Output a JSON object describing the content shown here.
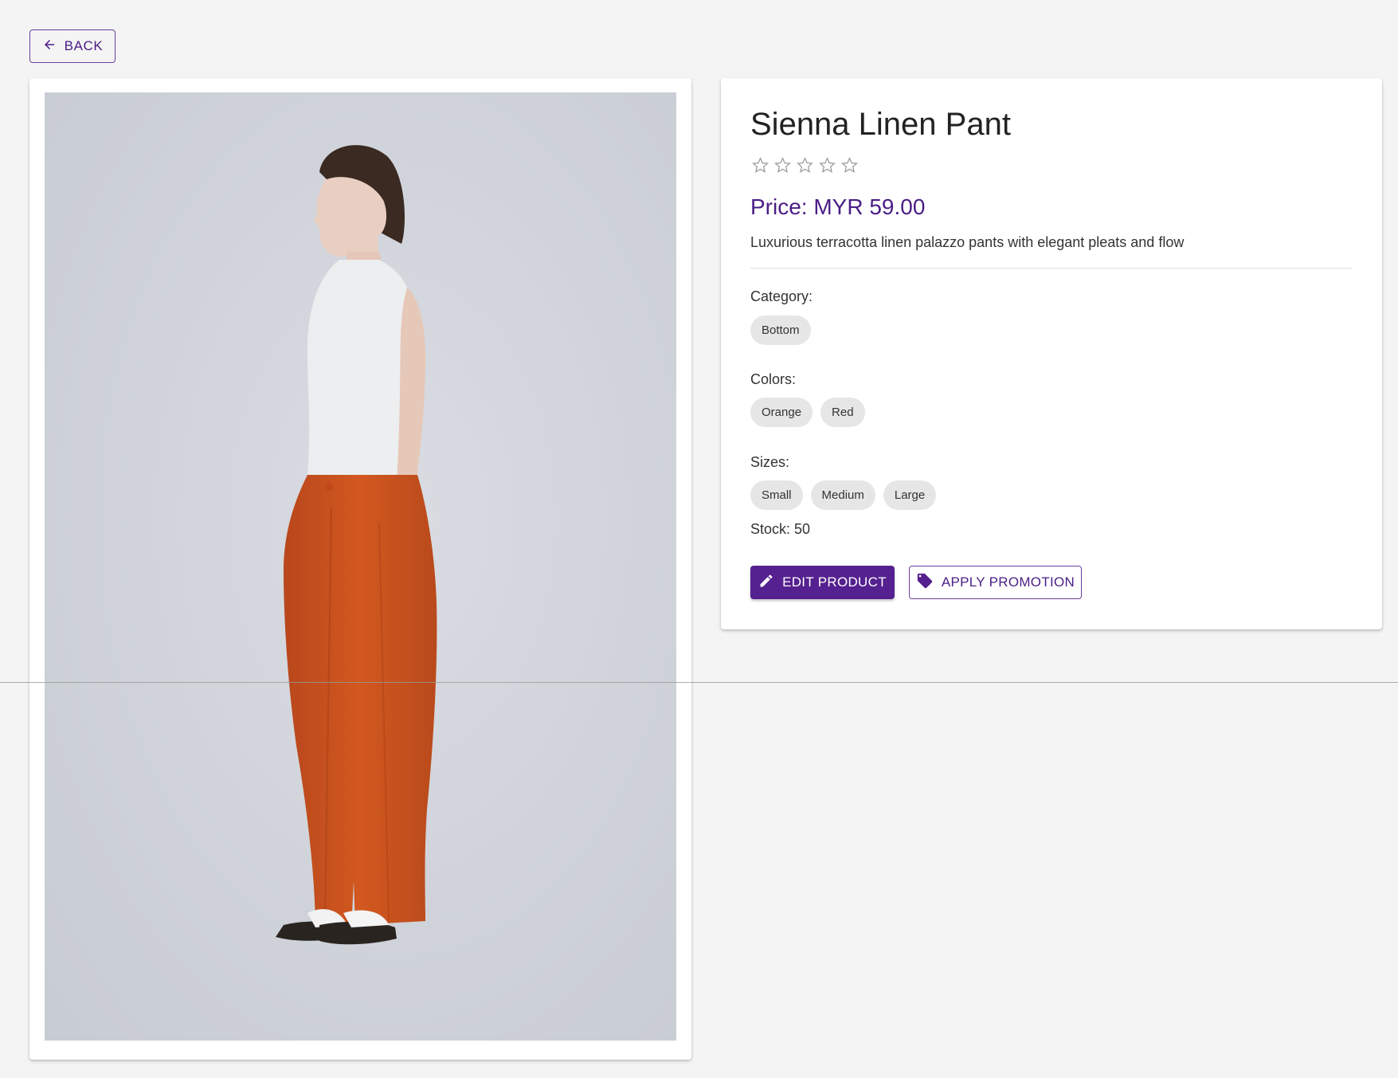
{
  "nav": {
    "back_label": "BACK"
  },
  "product": {
    "image_alt": "Model wearing orange linen palazzo pants and white sleeveless top",
    "title": "Sienna Linen Pant",
    "rating": {
      "value": 0,
      "max": 5
    },
    "price_text": "Price: MYR 59.00",
    "description": "Luxurious terracotta linen palazzo pants with elegant pleats and flow",
    "category_label": "Category:",
    "categories": [
      "Bottom"
    ],
    "colors_label": "Colors:",
    "colors": [
      "Orange",
      "Red"
    ],
    "sizes_label": "Sizes:",
    "sizes": [
      "Small",
      "Medium",
      "Large"
    ],
    "stock_text": "Stock: 50"
  },
  "actions": {
    "edit_label": "EDIT PRODUCT",
    "promo_label": "APPLY PROMOTION"
  },
  "colors": {
    "accent": "#55208f",
    "page_bg": "#f4f4f4",
    "chip_bg": "#e6e6e6"
  }
}
